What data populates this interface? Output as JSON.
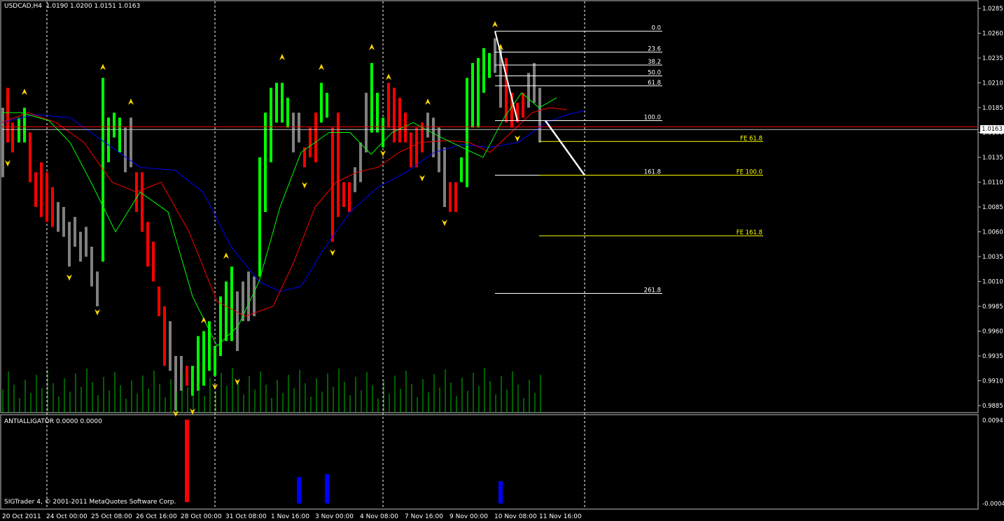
{
  "window": {
    "symbol_label": "USDCAD,H4",
    "ohlc_text": "1.0190 1.0200 1.0151 1.0163"
  },
  "indicator": {
    "name_text": "ANTIALLIGATOR 0.0000 0.0000",
    "scale_top": "0.0094",
    "scale_bottom": "-0.0004"
  },
  "footer": {
    "copyright": "SIGTrader 4, © 2001-2011 MetaQuotes Software Corp."
  },
  "colors": {
    "background": "#000000",
    "bull_bar": "#00ff00",
    "bear_bar": "#ff0000",
    "neutral_bar": "#808080",
    "fractal": "#ffd700",
    "jaw": "#0000ff",
    "teeth": "#ff0000",
    "lips": "#00ff00",
    "fib_level": "#ffffff",
    "fe_level": "#ffff00",
    "volume": "#00c000",
    "indicator_up": "#ff0000",
    "indicator_down": "#0000ff",
    "grid": "#ffffff"
  },
  "current_price_tag": "1.0163",
  "chart_data": {
    "type": "candlestick",
    "title": "USDCAD,H4",
    "y_axis_ticks": [
      "1.0285",
      "1.0260",
      "1.0235",
      "1.0210",
      "1.0185",
      "1.0160",
      "1.0135",
      "1.0110",
      "1.0085",
      "1.0060",
      "1.0035",
      "1.0010",
      "0.9985",
      "0.9960",
      "0.9935",
      "0.9910",
      "0.9885"
    ],
    "x_axis_ticks": [
      "20 Oct 2011",
      "24 Oct 00:00",
      "25 Oct 08:00",
      "26 Oct 16:00",
      "28 Oct 00:00",
      "31 Oct 08:00",
      "1 Nov 16:00",
      "3 Nov 00:00",
      "4 Nov 08:00",
      "7 Nov 16:00",
      "9 Nov 00:00",
      "10 Nov 08:00",
      "11 Nov 16:00"
    ],
    "ylim": [
      0.9885,
      1.0285
    ],
    "grid": "vertical dashed",
    "fibonacci_retracement": [
      {
        "label": "0.0",
        "price": 1.0262
      },
      {
        "label": "23.6",
        "price": 1.0241
      },
      {
        "label": "38.2",
        "price": 1.0228
      },
      {
        "label": "50.0",
        "price": 1.0217
      },
      {
        "label": "61.8",
        "price": 1.0207
      },
      {
        "label": "100.0",
        "price": 1.0172
      },
      {
        "label": "161.8",
        "price": 1.0117
      },
      {
        "label": "261.8",
        "price": 0.9998
      }
    ],
    "fibonacci_expansion": [
      {
        "label": "FE 61.8",
        "price": 1.0151
      },
      {
        "label": "FE 100.0",
        "price": 1.0117
      },
      {
        "label": "FE 161.8",
        "price": 1.0056
      }
    ],
    "current_price": 1.0163,
    "indicator_values": [
      {
        "bar": "28 Oct 00:00",
        "value": 0.0094,
        "direction": "up"
      },
      {
        "bar": "2 Nov",
        "value": 0.003,
        "direction": "down"
      },
      {
        "bar": "3 Nov",
        "value": 0.0034,
        "direction": "down"
      },
      {
        "bar": "10 Nov 08:00",
        "value": 0.0022,
        "direction": "down"
      }
    ]
  }
}
